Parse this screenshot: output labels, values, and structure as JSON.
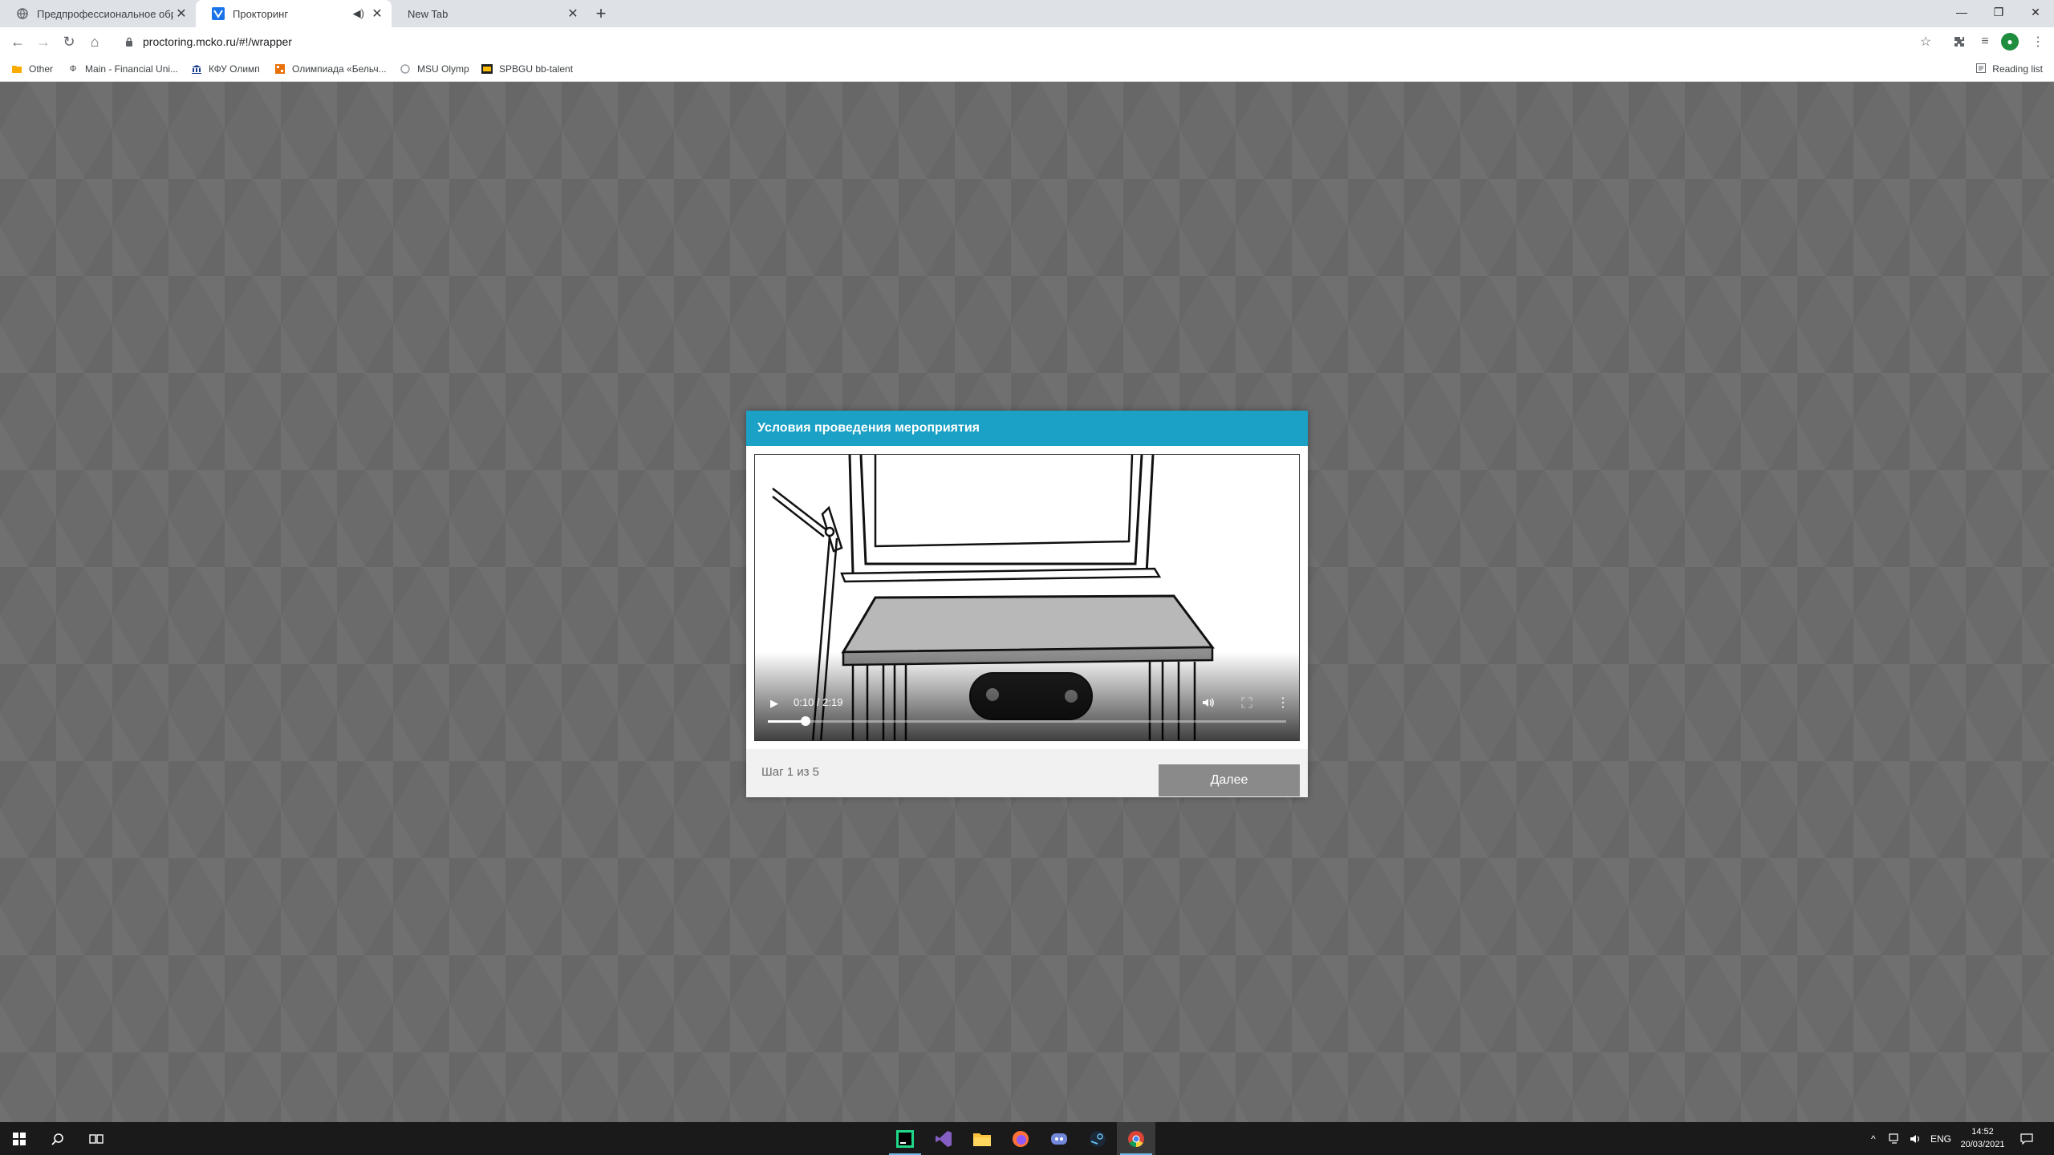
{
  "browser": {
    "tabs": [
      {
        "title": "Предпрофессиональное образ",
        "active": false,
        "icon": "globe-icon"
      },
      {
        "title": "Прокторинг",
        "active": true,
        "icon": "proctoring-favicon",
        "audio": true
      },
      {
        "title": "New Tab",
        "active": false
      }
    ],
    "url": "proctoring.mcko.ru/#!/wrapper",
    "bookmarks": [
      {
        "label": "Other",
        "icon": "folder-icon"
      },
      {
        "label": "Main - Financial Uni...",
        "icon": "fu-icon"
      },
      {
        "label": "КФУ Олимп",
        "icon": "building-icon"
      },
      {
        "label": "Олимпиада «Бельч...",
        "icon": "olymp-icon"
      },
      {
        "label": "MSU Olymp",
        "icon": "msu-icon"
      },
      {
        "label": "SPBGU bb-talent",
        "icon": "bb-icon"
      }
    ],
    "reading_list": "Reading list"
  },
  "modal": {
    "title": "Условия проведения мероприятия",
    "video": {
      "time": "0:10 / 2:19",
      "progress": 0.072
    },
    "step": "Шаг 1 из 5",
    "next_label": "Далее"
  },
  "taskbar": {
    "lang": "ENG",
    "time": "14:52",
    "date": "20/03/2021"
  }
}
